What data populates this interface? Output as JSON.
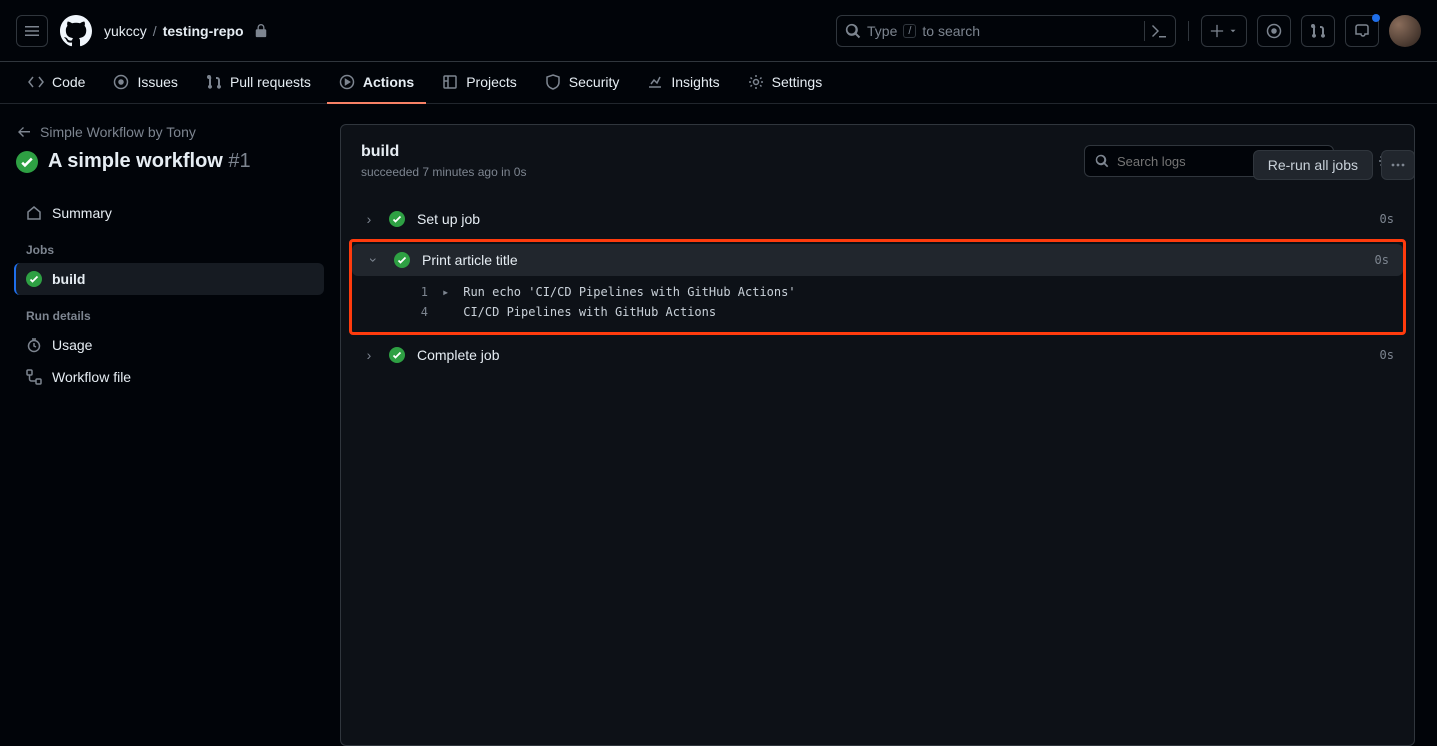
{
  "breadcrumb": {
    "owner": "yukccy",
    "repo": "testing-repo"
  },
  "search": {
    "prefix": "Type",
    "key": "/",
    "suffix": "to search"
  },
  "nav": {
    "code": "Code",
    "issues": "Issues",
    "pull": "Pull requests",
    "actions": "Actions",
    "projects": "Projects",
    "security": "Security",
    "insights": "Insights",
    "settings": "Settings"
  },
  "backlink": "Simple Workflow by Tony",
  "workflow": {
    "title": "A simple workflow",
    "run_number": "#1"
  },
  "header_actions": {
    "rerun": "Re-run all jobs"
  },
  "sidebar": {
    "summary": "Summary",
    "jobs_label": "Jobs",
    "job_build": "build",
    "run_details_label": "Run details",
    "usage": "Usage",
    "workflow_file": "Workflow file"
  },
  "job": {
    "name": "build",
    "status_line": "succeeded 7 minutes ago in 0s",
    "search_placeholder": "Search logs"
  },
  "steps": [
    {
      "name": "Set up job",
      "duration": "0s",
      "expanded": false
    },
    {
      "name": "Print article title",
      "duration": "0s",
      "expanded": true
    },
    {
      "name": "Complete job",
      "duration": "0s",
      "expanded": false
    }
  ],
  "log": {
    "l1_num": "1",
    "l1_text": "Run echo 'CI/CD Pipelines with GitHub Actions'",
    "l4_num": "4",
    "l4_text": "CI/CD Pipelines with GitHub Actions"
  }
}
